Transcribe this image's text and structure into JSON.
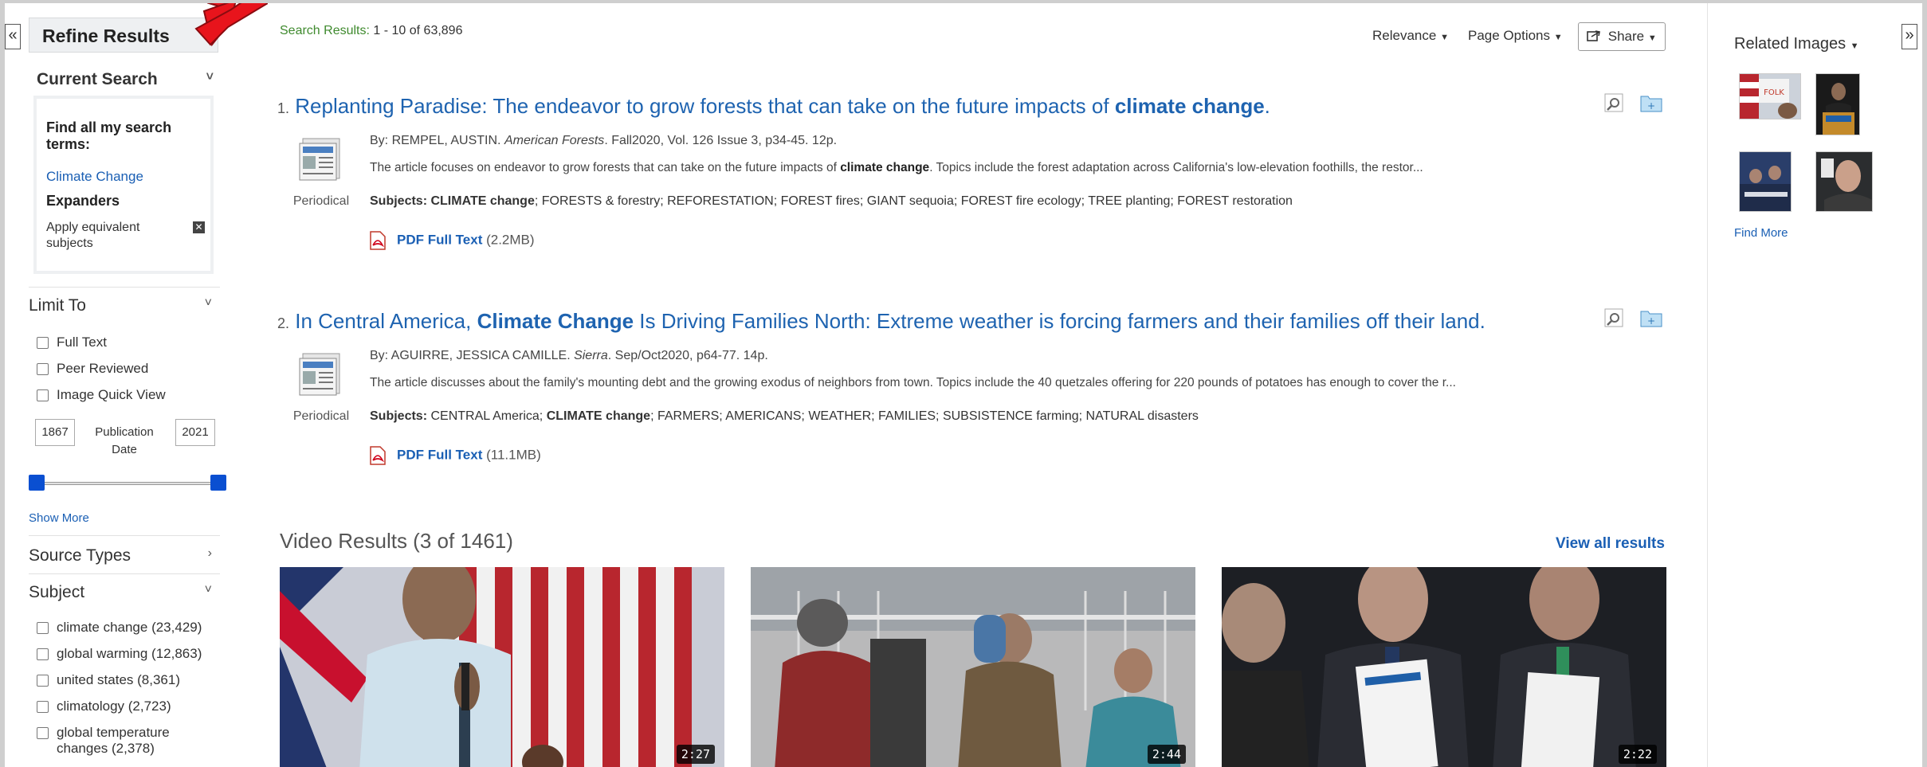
{
  "toggles": {
    "left": "«",
    "right": "»"
  },
  "sidebar": {
    "title": "Refine Results",
    "current_search": {
      "label": "Current Search",
      "find_all": "Find all my search terms:",
      "term": "Climate Change",
      "expanders_label": "Expanders",
      "expander_item": "Apply equivalent subjects"
    },
    "limit_to": {
      "label": "Limit To",
      "options": [
        "Full Text",
        "Peer Reviewed",
        "Image Quick View"
      ],
      "date_from": "1867",
      "date_label_1": "Publication",
      "date_label_2": "Date",
      "date_to": "2021",
      "show_more": "Show More"
    },
    "source_types": {
      "label": "Source Types"
    },
    "subject": {
      "label": "Subject",
      "items": [
        "climate change (23,429)",
        "global warming (12,863)",
        "united states (8,361)",
        "climatology (2,723)",
        "global temperature",
        "changes (2,378)"
      ]
    }
  },
  "header": {
    "results_label": "Search Results:",
    "results_range": "1 - 10 of 63,896",
    "relevance": "Relevance",
    "page_options": "Page Options",
    "share": "Share"
  },
  "results": [
    {
      "number": "1.",
      "title_pre": "Replanting Paradise: The endeavor to grow forests that can take on the future impacts of ",
      "title_bold": "climate change",
      "title_post": ".",
      "by": "By: REMPEL, AUSTIN. ",
      "source": "American Forests",
      "details": ". Fall2020, Vol. 126 Issue 3, p34-45. 12p.",
      "abstract_pre": "The article focuses on endeavor to grow forests that can take on the future impacts of ",
      "abstract_bold": "climate change",
      "abstract_post": ". Topics include the forest adaptation across California's low-elevation foothills, the restor...",
      "subjects_label": "Subjects:",
      "subjects_bold": "CLIMATE change",
      "subjects_rest": "; FORESTS & forestry; REFORESTATION; FOREST fires; GIANT sequoia; FOREST fire ecology; TREE planting; FOREST restoration",
      "type": "Periodical",
      "pdf_label": "PDF Full Text",
      "pdf_size": "(2.2MB)"
    },
    {
      "number": "2.",
      "title_pre": "In Central America, ",
      "title_bold": "Climate Change",
      "title_post": " Is Driving Families North: Extreme weather is forcing farmers and their families off their land.",
      "by": "By: AGUIRRE, JESSICA CAMILLE. ",
      "source": "Sierra",
      "details": ". Sep/Oct2020, p64-77. 14p.",
      "abstract_pre": "The article discusses about the family's mounting debt and the growing exodus of neighbors from town. Topics include the 40 quetzales offering for 220 pounds of potatoes has enough to cover the r...",
      "subjects_label": "Subjects:",
      "subjects_pre": " CENTRAL America; ",
      "subjects_bold": "CLIMATE change",
      "subjects_rest": "; FARMERS; AMERICANS; WEATHER; FAMILIES; SUBSISTENCE farming; NATURAL disasters",
      "type": "Periodical",
      "pdf_label": "PDF Full Text",
      "pdf_size": "(11.1MB)"
    }
  ],
  "videos": {
    "heading": "Video Results (3 of 1461)",
    "view_all": "View all results",
    "durations": [
      "2:27",
      "2:44",
      "2:22"
    ]
  },
  "related": {
    "label": "Related Images",
    "find_more": "Find More"
  },
  "colors": {
    "link": "#1e63b0",
    "panel": "#eef0f2",
    "arrow": "#e8141c",
    "green": "#3f8a2e"
  }
}
